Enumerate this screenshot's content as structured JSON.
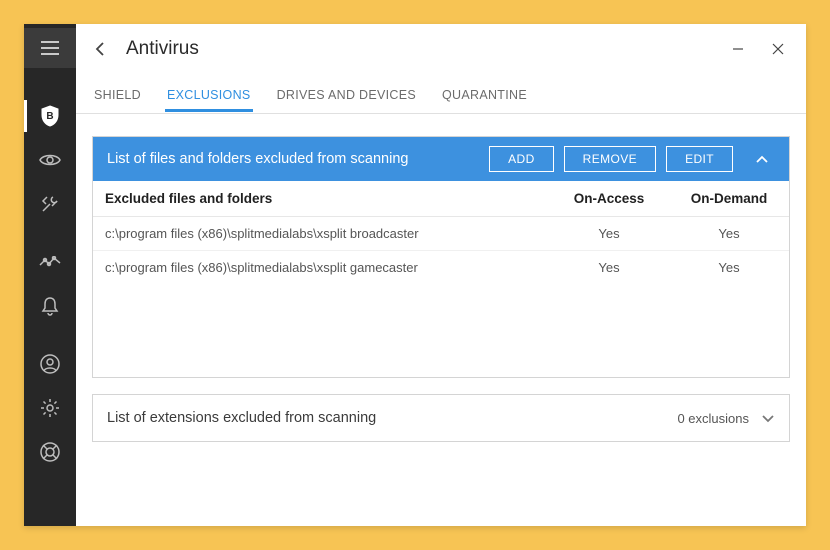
{
  "window": {
    "title": "Antivirus"
  },
  "tabs": [
    {
      "label": "SHIELD",
      "active": false
    },
    {
      "label": "EXCLUSIONS",
      "active": true
    },
    {
      "label": "DRIVES AND DEVICES",
      "active": false
    },
    {
      "label": "QUARANTINE",
      "active": false
    }
  ],
  "files_panel": {
    "title": "List of files and folders excluded from scanning",
    "buttons": {
      "add": "ADD",
      "remove": "REMOVE",
      "edit": "EDIT"
    },
    "columns": {
      "path": "Excluded files and folders",
      "on_access": "On-Access",
      "on_demand": "On-Demand"
    },
    "rows": [
      {
        "path": "c:\\program files (x86)\\splitmedialabs\\xsplit broadcaster",
        "on_access": "Yes",
        "on_demand": "Yes"
      },
      {
        "path": "c:\\program files (x86)\\splitmedialabs\\xsplit gamecaster",
        "on_access": "Yes",
        "on_demand": "Yes"
      }
    ]
  },
  "ext_panel": {
    "title": "List of extensions excluded from scanning",
    "count_label": "0 exclusions"
  },
  "colors": {
    "accent": "#3d91df",
    "bg": "#f7c454"
  }
}
